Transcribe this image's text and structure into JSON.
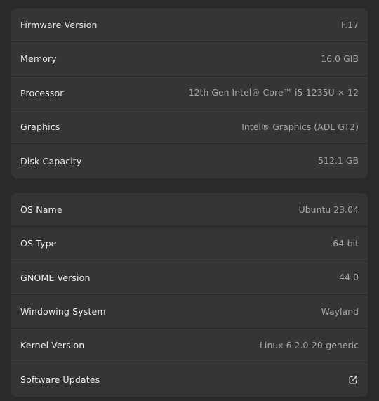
{
  "hardware": {
    "rows": [
      {
        "label": "Firmware Version",
        "value": "F.17"
      },
      {
        "label": "Memory",
        "value": "16.0 GIB"
      },
      {
        "label": "Processor",
        "value": "12th Gen Intel® Core™ i5-1235U × 12"
      },
      {
        "label": "Graphics",
        "value": "Intel® Graphics (ADL GT2)"
      },
      {
        "label": "Disk Capacity",
        "value": "512.1 GB"
      }
    ]
  },
  "software": {
    "rows": [
      {
        "label": "OS Name",
        "value": "Ubuntu 23.04"
      },
      {
        "label": "OS Type",
        "value": "64-bit"
      },
      {
        "label": "GNOME Version",
        "value": "44.0"
      },
      {
        "label": "Windowing System",
        "value": "Wayland"
      },
      {
        "label": "Kernel Version",
        "value": "Linux 6.2.0-20-generic"
      }
    ],
    "updates_label": "Software Updates",
    "updates_icon": "external-link-icon"
  }
}
